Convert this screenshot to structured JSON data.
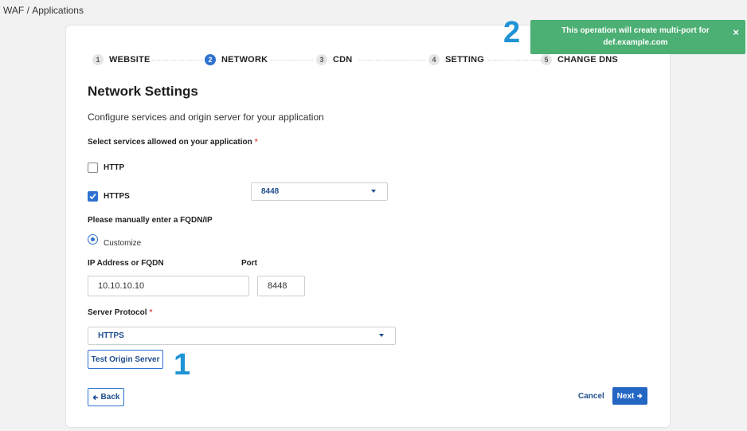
{
  "breadcrumb": {
    "root": "WAF",
    "separator": "/",
    "current": "Applications"
  },
  "steps": [
    {
      "num": "1",
      "label": "WEBSITE"
    },
    {
      "num": "2",
      "label": "NETWORK",
      "active": true
    },
    {
      "num": "3",
      "label": "CDN"
    },
    {
      "num": "4",
      "label": "SETTING"
    },
    {
      "num": "5",
      "label": "CHANGE DNS"
    }
  ],
  "form": {
    "title": "Network Settings",
    "subtitle": "Configure services and origin server for your application",
    "services_label": "Select services allowed on your application",
    "required_mark": "*",
    "services": [
      {
        "label": "HTTP",
        "checked": false
      },
      {
        "label": "HTTPS",
        "checked": true
      }
    ],
    "https_port_select": "8448",
    "fqdn_label": "Please manually enter a FQDN/IP",
    "radio_customize": "Customize",
    "ip_label": "IP Address or FQDN",
    "ip_value": "10.10.10.10",
    "port_label": "Port",
    "port_value": "8448",
    "protocol_label": "Server Protocol",
    "protocol_value": "HTTPS",
    "test_button": "Test Origin Server"
  },
  "footer": {
    "back": "Back",
    "cancel": "Cancel",
    "next": "Next"
  },
  "markers": {
    "one": "1",
    "two": "2"
  },
  "toast": {
    "message": "This operation will create multi-port for def.example.com",
    "close": "×"
  },
  "colors": {
    "accent": "#2f72cf",
    "toast": "#4caf73",
    "marker": "#1e93d6"
  }
}
